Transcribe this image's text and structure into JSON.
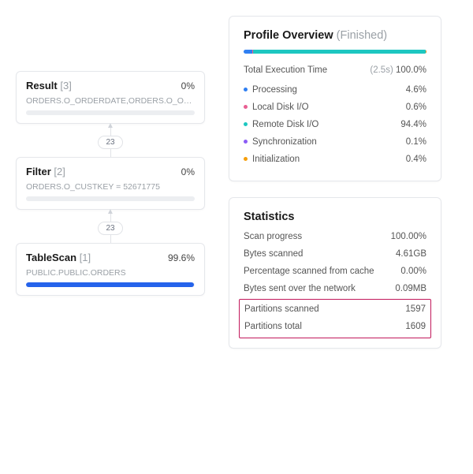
{
  "tree": {
    "result": {
      "name": "Result",
      "idx": "[3]",
      "pct": "0%",
      "desc": "ORDERS.O_ORDERDATE,ORDERS.O_OR...",
      "fill": 0
    },
    "filter": {
      "name": "Filter",
      "idx": "[2]",
      "pct": "0%",
      "desc": "ORDERS.O_CUSTKEY = 52671775",
      "fill": 0
    },
    "scan": {
      "name": "TableScan",
      "idx": "[1]",
      "pct": "99.6%",
      "desc": "PUBLIC.PUBLIC.ORDERS",
      "fill": 99.6
    },
    "edge1": "23",
    "edge2": "23"
  },
  "overview": {
    "title": "Profile Overview",
    "status": "(Finished)",
    "total": {
      "label": "Total Execution Time",
      "time": "(2.5s)",
      "pct": "100.0%"
    },
    "rows": [
      {
        "label": "Processing",
        "pct": "4.6%",
        "color": "#2f7ff2"
      },
      {
        "label": "Local Disk I/O",
        "pct": "0.6%",
        "color": "#e85f92"
      },
      {
        "label": "Remote Disk I/O",
        "pct": "94.4%",
        "color": "#1dc7c1"
      },
      {
        "label": "Synchronization",
        "pct": "0.1%",
        "color": "#8b5cf6"
      },
      {
        "label": "Initialization",
        "pct": "0.4%",
        "color": "#f59e0b"
      }
    ]
  },
  "stats": {
    "title": "Statistics",
    "rows": [
      {
        "label": "Scan progress",
        "val": "100.00%"
      },
      {
        "label": "Bytes scanned",
        "val": "4.61GB"
      },
      {
        "label": "Percentage scanned from cache",
        "val": "0.00%"
      },
      {
        "label": "Bytes sent over the network",
        "val": "0.09MB"
      }
    ],
    "highlight": [
      {
        "label": "Partitions scanned",
        "val": "1597"
      },
      {
        "label": "Partitions total",
        "val": "1609"
      }
    ]
  }
}
